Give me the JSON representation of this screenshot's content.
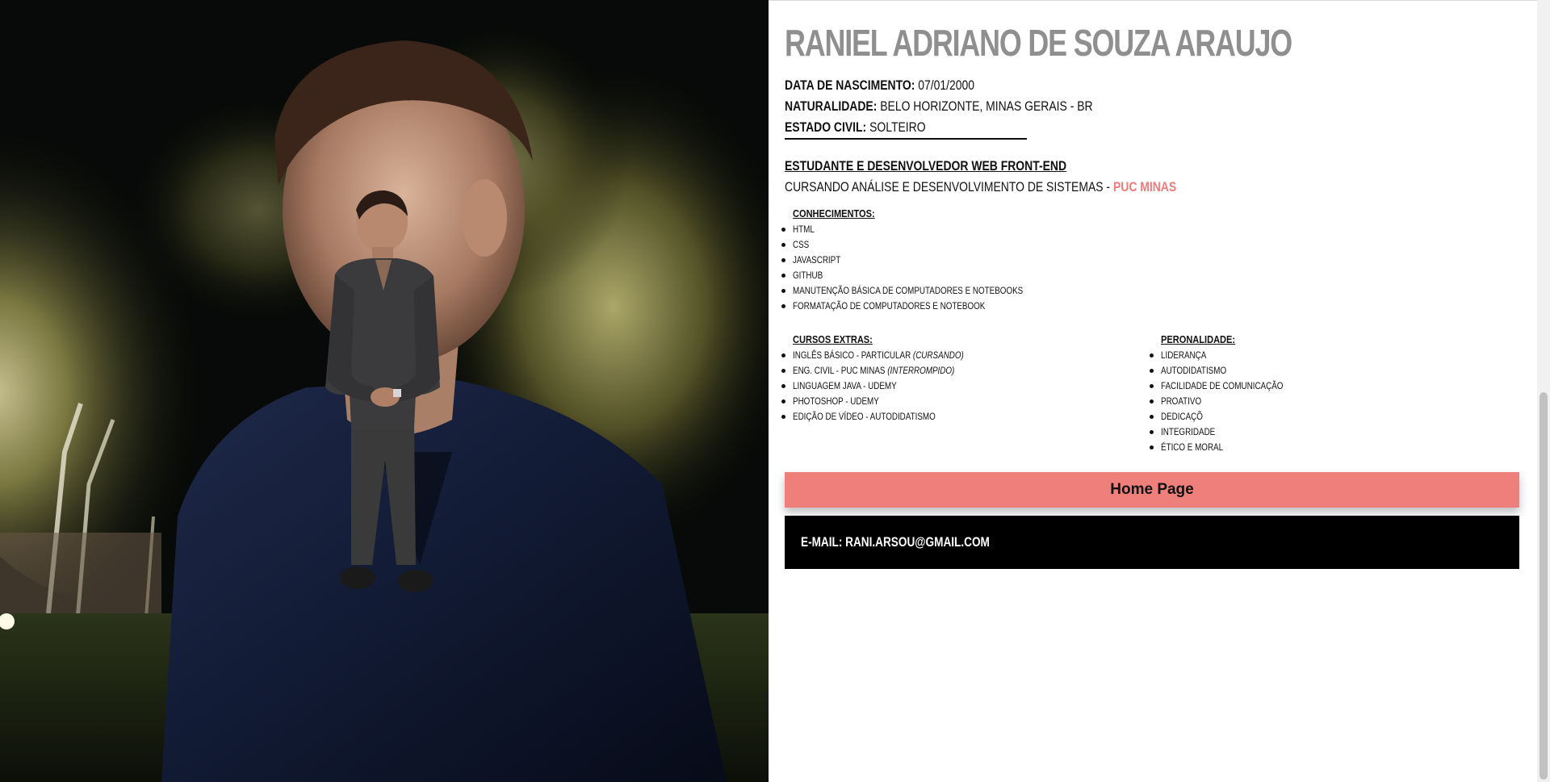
{
  "profile": {
    "name": "Raniel Adriano de Souza Araujo",
    "birth_label": "Data de nascimento:",
    "birth_value": "07/01/2000",
    "origin_label": "Naturalidade:",
    "origin_value": "Belo Horizonte, Minas Gerais - BR",
    "civil_label": "Estado Civil:",
    "civil_value": "Solteiro"
  },
  "role": {
    "title": "Estudante e desenvolvedor web front-end",
    "course_prefix": "Cursando Análise e Desenvolvimento de Sistemas -",
    "course_school": "PUC MINAS"
  },
  "knowledge": {
    "title": "Conhecimentos:",
    "items": [
      "HTML",
      "CSS",
      "JAVASCRIPT",
      "GITHUB",
      "Manutenção básica de computadores e notebooks",
      "Formatação de computadores e notebook"
    ]
  },
  "courses": {
    "title": "Cursos Extras:",
    "items": [
      {
        "text": "Inglês básico - particular",
        "note": "(cursando)"
      },
      {
        "text": "Eng. Civil - PUC MINAS",
        "note": "(interrompido)"
      },
      {
        "text": "Linguagem Java - Udemy",
        "note": ""
      },
      {
        "text": "Photoshop - Udemy",
        "note": ""
      },
      {
        "text": "Edição de vídeo - autodidatismo",
        "note": ""
      }
    ]
  },
  "personality": {
    "title": "Peronalidade:",
    "items": [
      "Liderança",
      "Autodidatismo",
      "Facilidade de comunicação",
      "Proativo",
      "Dedicaçõ",
      "Integridade",
      "Ético e moral"
    ]
  },
  "nav": {
    "home_label": "Home Page"
  },
  "footer": {
    "email": "E-mail: rani.arsou@gmail.com"
  },
  "colors": {
    "accent": "#ef7f7a",
    "name_gray": "#8f8f8f",
    "footer_bg": "#000000"
  }
}
